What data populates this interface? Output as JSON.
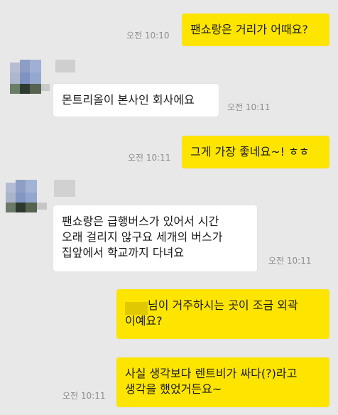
{
  "colors": {
    "background": "#e8e8e8",
    "my_bubble": "#fee500",
    "other_bubble": "#ffffff",
    "timestamp": "#8d8d8d"
  },
  "messages": [
    {
      "sender": "me",
      "lines": [
        "팬쇼랑은 거리가 어때요?"
      ],
      "time": "오전 10:10"
    },
    {
      "sender": "other",
      "lines": [
        "몬트리올이 본사인 회사에요"
      ],
      "time": "오전 10:11"
    },
    {
      "sender": "me",
      "lines": [
        "그게 가장 좋네요~! ㅎㅎ"
      ],
      "time": "오전 10:11"
    },
    {
      "sender": "other",
      "lines": [
        "팬쇼랑은 급행버스가 있어서 시간",
        "오래 걸리지 않구요 세개의 버스가",
        "집앞에서 학교까지 다녀요"
      ],
      "time": "오전 10:11"
    },
    {
      "sender": "me",
      "lines": [
        "님이 거주하시는 곳이 조금 외곽",
        "이예요?"
      ],
      "time": ""
    },
    {
      "sender": "me",
      "lines": [
        "사실 생각보다 렌트비가 싸다(?)라고",
        "생각을 했었거든요~"
      ],
      "time": "오전 10:11"
    }
  ]
}
